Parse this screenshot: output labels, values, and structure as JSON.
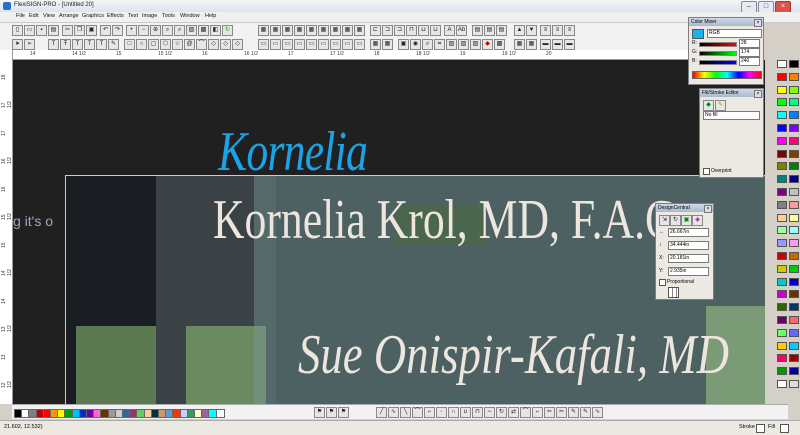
{
  "window": {
    "title": "FlexiSIGN-PRO - [Untitled 20]"
  },
  "titlebar_buttons": [
    "–",
    "□",
    "×"
  ],
  "menu": [
    "File",
    "Edit",
    "View",
    "Arrange",
    "Graphics",
    "Effects",
    "Text",
    "Image",
    "Tools",
    "Window",
    "Help"
  ],
  "ruler": {
    "h_labels": [
      "14",
      "14 1/2",
      "15",
      "15 1/2",
      "16",
      "16 1/2",
      "17",
      "17 1/2",
      "18",
      "18 1/2",
      "19",
      "19 1/2",
      "20"
    ],
    "v_labels": [
      "18",
      "17 1/2",
      "17",
      "16 1/2",
      "16",
      "15 1/2",
      "15",
      "14 1/2",
      "14",
      "13 1/2",
      "13",
      "12 1/2"
    ]
  },
  "canvas": {
    "title_text": "Kornelia",
    "line1": "Kornelia Krol, MD, F.A.C",
    "line2": "Sue Onispir-Kafali, MD",
    "partial_text": "g it's o",
    "colors": {
      "title": "#1aa3e6",
      "body": "#ece6df"
    }
  },
  "color_mixer": {
    "title": "Color Mixer",
    "mode": "RGB",
    "labels": [
      "R:",
      "G:",
      "B:"
    ],
    "values": [
      "28",
      "174",
      "240"
    ],
    "swatch": "#1cb0ee"
  },
  "fill_stroke": {
    "title": "Fill/Stroke Editor",
    "fill": "No fill",
    "overprint_label": "Overprint"
  },
  "design_central": {
    "title": "DesignCentral",
    "labels": [
      "↔",
      "↕",
      "X:",
      "Y:"
    ],
    "values": [
      "26.667in",
      "34.444in",
      "20.181in",
      "2.935in"
    ],
    "proportional_label": "Proportional"
  },
  "status": {
    "coords": "21.602, 12.532)",
    "stroke_label": "Stroke",
    "fill_label": "Fill"
  },
  "bottom_swatches": [
    "#000000",
    "#ffffff",
    "#7f7f7f",
    "#c00000",
    "#ff0000",
    "#ff9900",
    "#ffff00",
    "#00a000",
    "#00c0ff",
    "#0030c0",
    "#7000a0",
    "#ff66cc",
    "#663300",
    "#999999",
    "#cccccc",
    "#336699",
    "#993366",
    "#66cc66",
    "#ffcc99",
    "#003333",
    "#cc9966",
    "#6699cc",
    "#ff3300",
    "#ccccff",
    "#339966",
    "#ffffcc",
    "#996699",
    "#00ffff",
    "#ffffff"
  ],
  "palette": [
    "#ffffff",
    "#000000",
    "#ff0000",
    "#ff8000",
    "#ffff00",
    "#80ff00",
    "#00ff00",
    "#00ff80",
    "#00ffff",
    "#0080ff",
    "#0000ff",
    "#8000ff",
    "#ff00ff",
    "#ff0080",
    "#800000",
    "#804000",
    "#808000",
    "#008000",
    "#008080",
    "#000080",
    "#800080",
    "#c0c0c0",
    "#808080",
    "#ff9999",
    "#ffcc99",
    "#ffff99",
    "#99ff99",
    "#99ffff",
    "#9999ff",
    "#ff99ff",
    "#cc0000",
    "#cc6600",
    "#cccc00",
    "#00cc00",
    "#00cccc",
    "#0000cc",
    "#cc00cc",
    "#663300",
    "#336600",
    "#003366",
    "#660066",
    "#ff6666",
    "#66ff66",
    "#6666ff",
    "#ffcc00",
    "#00ccff",
    "#ff0066",
    "#990000",
    "#009900",
    "#000099",
    "#ffffff",
    "#dddddd"
  ]
}
